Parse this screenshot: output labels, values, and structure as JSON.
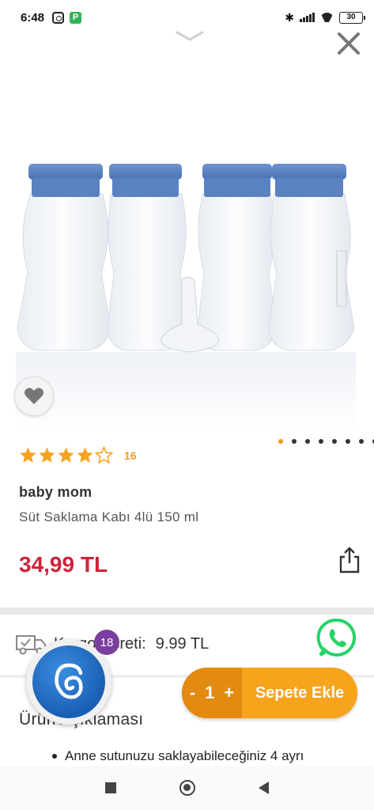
{
  "status_bar": {
    "time": "6:48",
    "battery": "30"
  },
  "product": {
    "rating": 4,
    "review_count": "16",
    "brand": "baby mom",
    "name": "Süt Saklama Kabı 4lü 150 ml",
    "price": "34,99 TL",
    "image_count": 8,
    "active_image": 1
  },
  "shipping": {
    "label": "Kargo Ücreti:",
    "value": "9.99 TL"
  },
  "assistant": {
    "badge_count": "18"
  },
  "description": {
    "title": "Ürün Açıklaması",
    "first_item": "Anne sutunuzu saklayabileceğiniz 4 ayrı"
  },
  "cart": {
    "minus": "-",
    "quantity": "1",
    "plus": "+",
    "add_label": "Sepete Ekle"
  },
  "colors": {
    "accent": "#f7a31c",
    "price": "#d0223a",
    "whatsapp": "#25d366",
    "cap": "#5b84c4"
  }
}
